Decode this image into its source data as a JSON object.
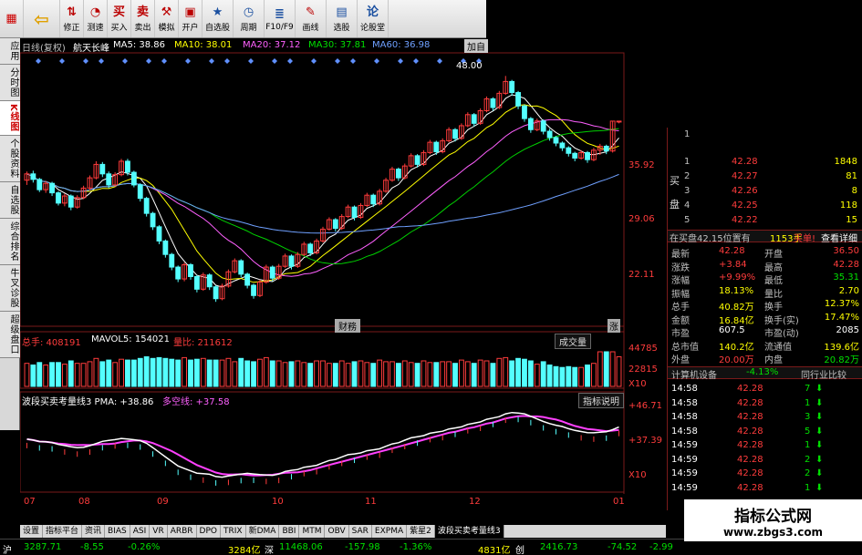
{
  "toolbar": {
    "buttons": [
      {
        "label": "",
        "icon": "grid-icon"
      },
      {
        "label": "",
        "icon": "back-arrow-icon"
      },
      {
        "label": "修正",
        "icon": "updown-icon"
      },
      {
        "label": "测速",
        "icon": "speed-icon"
      },
      {
        "label": "买入",
        "icon": "buy-icon"
      },
      {
        "label": "卖出",
        "icon": "sell-icon"
      },
      {
        "label": "模拟",
        "icon": "hammer-icon"
      },
      {
        "label": "开户",
        "icon": "account-icon"
      },
      {
        "label": "自选股",
        "icon": "star-icon"
      },
      {
        "label": "周期",
        "icon": "clock-icon"
      },
      {
        "label": "F10/F9",
        "icon": "f10-icon"
      },
      {
        "label": "画线",
        "icon": "pen-icon"
      },
      {
        "label": "选股",
        "icon": "filter-icon"
      },
      {
        "label": "论股堂",
        "icon": "forum-icon"
      }
    ]
  },
  "left_tabs": [
    "应用",
    "分时图",
    "K线图",
    "个股资料",
    "自选股",
    "综合排名",
    "牛叉诊股",
    "超级盘口"
  ],
  "active_left_tab": 2,
  "header": {
    "period": "日线(复权)",
    "stock": "航天长峰",
    "ma5": "MA5: 38.86",
    "ma10": "MA10: 38.01",
    "ma20": "MA20: 37.12",
    "ma30": "MA30: 37.81",
    "ma60": "MA60: 36.98",
    "add_label": "加自"
  },
  "price_axis": [
    "35.92",
    "29.06",
    "22.11"
  ],
  "price_high_label": "48.00",
  "markers": [
    "财務",
    "涨"
  ],
  "volume": {
    "total": "总手: 408191",
    "mavol5": "MAVOL5: 154021",
    "ratio": "量比: 211612",
    "panel_label": "成交量",
    "axis": [
      "44785",
      "22815",
      "X10"
    ]
  },
  "indicator": {
    "name": "波段买卖考量线3 PMA: +38.86",
    "line2": "多空线: +37.58",
    "panel_label": "指标说明",
    "axis": [
      "+46.71",
      "+37.39",
      "X10"
    ]
  },
  "x_axis": [
    "07",
    "08",
    "09",
    "10",
    "11",
    "12",
    "01"
  ],
  "chart_data": {
    "type": "candlestick",
    "price_range": [
      17,
      50
    ],
    "candles": [
      [
        34.8,
        35.6,
        34.2,
        35.9
      ],
      [
        35.6,
        34.9,
        34.5,
        36.0
      ],
      [
        34.9,
        33.6,
        33.3,
        35.1
      ],
      [
        33.6,
        34.4,
        33.2,
        34.7
      ],
      [
        34.4,
        33.2,
        32.8,
        34.6
      ],
      [
        33.2,
        31.9,
        31.6,
        33.4
      ],
      [
        31.9,
        32.8,
        31.5,
        33.1
      ],
      [
        32.8,
        31.4,
        31.0,
        33.0
      ],
      [
        31.4,
        32.6,
        31.2,
        32.9
      ],
      [
        32.6,
        33.8,
        32.4,
        34.1
      ],
      [
        33.8,
        35.1,
        33.5,
        35.4
      ],
      [
        35.1,
        36.8,
        34.9,
        37.2
      ],
      [
        36.8,
        35.6,
        35.2,
        37.1
      ],
      [
        35.6,
        34.2,
        33.8,
        35.9
      ],
      [
        34.2,
        35.5,
        34.0,
        35.8
      ],
      [
        35.5,
        37.2,
        35.3,
        37.5
      ],
      [
        37.2,
        35.8,
        35.4,
        37.5
      ],
      [
        35.8,
        34.2,
        33.9,
        36.0
      ],
      [
        34.2,
        32.5,
        32.1,
        34.4
      ],
      [
        32.5,
        30.6,
        30.2,
        32.7
      ],
      [
        30.6,
        28.9,
        28.5,
        30.8
      ],
      [
        28.9,
        27.1,
        26.7,
        29.1
      ],
      [
        27.1,
        25.4,
        25.0,
        27.3
      ],
      [
        25.4,
        23.8,
        23.4,
        25.6
      ],
      [
        23.8,
        22.3,
        21.9,
        24.0
      ],
      [
        22.3,
        24.1,
        22.0,
        24.4
      ],
      [
        24.1,
        22.6,
        22.2,
        24.3
      ],
      [
        22.6,
        21.0,
        20.6,
        22.8
      ],
      [
        21.0,
        22.8,
        20.8,
        23.1
      ],
      [
        22.8,
        21.3,
        20.9,
        23.0
      ],
      [
        21.3,
        19.8,
        19.4,
        21.5
      ],
      [
        19.8,
        21.4,
        19.6,
        21.7
      ],
      [
        21.4,
        23.2,
        21.2,
        23.5
      ],
      [
        23.2,
        24.6,
        23.0,
        24.9
      ],
      [
        24.6,
        22.9,
        22.5,
        24.8
      ],
      [
        22.9,
        21.5,
        21.1,
        23.1
      ],
      [
        21.5,
        20.2,
        19.8,
        21.7
      ],
      [
        20.2,
        21.9,
        20.0,
        22.2
      ],
      [
        21.9,
        23.8,
        21.7,
        24.1
      ],
      [
        23.8,
        22.4,
        22.0,
        24.0
      ],
      [
        22.4,
        23.9,
        22.2,
        24.2
      ],
      [
        23.9,
        25.2,
        23.7,
        25.5
      ],
      [
        25.2,
        23.9,
        23.5,
        25.4
      ],
      [
        23.9,
        25.4,
        23.7,
        25.7
      ],
      [
        25.4,
        26.7,
        25.2,
        27.0
      ],
      [
        26.7,
        25.6,
        25.2,
        26.9
      ],
      [
        25.6,
        27.1,
        25.4,
        27.4
      ],
      [
        27.1,
        28.6,
        26.9,
        28.9
      ],
      [
        28.6,
        29.8,
        28.4,
        30.1
      ],
      [
        29.8,
        28.7,
        28.3,
        30.0
      ],
      [
        28.7,
        30.2,
        28.5,
        30.5
      ],
      [
        30.2,
        31.4,
        30.0,
        31.7
      ],
      [
        31.4,
        30.1,
        29.7,
        31.6
      ],
      [
        30.1,
        31.6,
        29.9,
        31.9
      ],
      [
        31.6,
        32.9,
        31.4,
        33.2
      ],
      [
        32.9,
        31.8,
        31.4,
        33.1
      ],
      [
        31.8,
        33.4,
        31.6,
        33.7
      ],
      [
        33.4,
        34.8,
        33.2,
        35.1
      ],
      [
        34.8,
        36.2,
        34.6,
        36.5
      ],
      [
        36.2,
        35.1,
        34.7,
        36.4
      ],
      [
        35.1,
        36.6,
        34.9,
        36.9
      ],
      [
        36.6,
        37.9,
        36.4,
        38.2
      ],
      [
        37.9,
        36.8,
        36.4,
        38.1
      ],
      [
        36.8,
        38.3,
        36.6,
        38.6
      ],
      [
        38.3,
        39.6,
        38.1,
        39.9
      ],
      [
        39.6,
        38.4,
        38.0,
        39.8
      ],
      [
        38.4,
        39.8,
        38.2,
        40.1
      ],
      [
        39.8,
        41.2,
        39.6,
        41.5
      ],
      [
        41.2,
        40.1,
        39.7,
        41.4
      ],
      [
        40.1,
        41.7,
        39.9,
        42.0
      ],
      [
        41.7,
        43.1,
        41.5,
        43.4
      ],
      [
        43.1,
        42.0,
        41.6,
        43.3
      ],
      [
        42.0,
        43.6,
        41.8,
        43.9
      ],
      [
        43.6,
        45.1,
        43.4,
        45.4
      ],
      [
        45.1,
        44.0,
        43.6,
        45.3
      ],
      [
        44.0,
        45.8,
        43.8,
        46.1
      ],
      [
        45.8,
        47.3,
        45.6,
        48.0
      ],
      [
        47.3,
        45.9,
        45.5,
        47.5
      ],
      [
        45.9,
        44.2,
        43.8,
        46.1
      ],
      [
        44.2,
        42.6,
        42.2,
        44.4
      ],
      [
        42.6,
        41.2,
        40.8,
        42.8
      ],
      [
        41.2,
        42.3,
        41.0,
        42.6
      ],
      [
        42.3,
        41.0,
        40.6,
        42.5
      ],
      [
        41.0,
        40.2,
        39.8,
        41.3
      ],
      [
        40.2,
        39.5,
        39.1,
        40.4
      ],
      [
        39.5,
        38.9,
        38.5,
        39.7
      ],
      [
        38.9,
        38.2,
        37.8,
        39.1
      ],
      [
        38.2,
        37.6,
        37.2,
        38.4
      ],
      [
        37.6,
        38.3,
        37.4,
        38.6
      ],
      [
        38.3,
        37.4,
        37.0,
        38.5
      ],
      [
        37.4,
        38.6,
        37.2,
        38.9
      ],
      [
        38.6,
        39.1,
        38.0,
        39.4
      ],
      [
        39.1,
        38.5,
        38.1,
        39.3
      ],
      [
        38.5,
        42.28,
        38.3,
        42.28
      ],
      [
        42.28,
        42.28,
        42.0,
        42.28
      ]
    ]
  },
  "orderbook": {
    "sell_top": {
      "level": "1",
      "price": "",
      "vol": ""
    },
    "buy_label": "买盘",
    "buy": [
      {
        "level": "1",
        "price": "42.28",
        "vol": "1848"
      },
      {
        "level": "2",
        "price": "42.27",
        "vol": "81"
      },
      {
        "level": "3",
        "price": "42.26",
        "vol": "8"
      },
      {
        "level": "4",
        "price": "42.25",
        "vol": "118"
      },
      {
        "level": "5",
        "price": "42.22",
        "vol": "15"
      }
    ],
    "status_left": "在买盘42.15位置有",
    "status_mid": "1153手",
    "status_right": "买单!",
    "detail_link": "查看详细"
  },
  "quote": [
    {
      "k1": "最新",
      "v1": "42.28",
      "c1": "red",
      "k2": "开盘",
      "v2": "36.50",
      "c2": "red"
    },
    {
      "k1": "涨跌",
      "v1": "+3.84",
      "c1": "red",
      "k2": "最高",
      "v2": "42.28",
      "c2": "red"
    },
    {
      "k1": "涨幅",
      "v1": "+9.99%",
      "c1": "red",
      "k2": "最低",
      "v2": "35.31",
      "c2": "green"
    },
    {
      "k1": "振幅",
      "v1": "18.13%",
      "c1": "yellow",
      "k2": "量比",
      "v2": "2.70",
      "c2": "yellow"
    },
    {
      "k1": "总手",
      "v1": "40.82万",
      "c1": "yellow",
      "k2": "换手",
      "v2": "12.37%",
      "c2": "yellow"
    },
    {
      "k1": "金额",
      "v1": "16.84亿",
      "c1": "yellow",
      "k2": "换手(实)",
      "v2": "17.47%",
      "c2": "yellow"
    },
    {
      "k1": "市盈",
      "v1": "607.5",
      "c1": "white",
      "k2": "市盈(动)",
      "v2": "2085",
      "c2": "white"
    },
    {
      "k1": "总市值",
      "v1": "140.2亿",
      "c1": "yellow",
      "k2": "流通值",
      "v2": "139.6亿",
      "c2": "yellow"
    },
    {
      "k1": "外盘",
      "v1": "20.00万",
      "c1": "red",
      "k2": "内盘",
      "v2": "20.82万",
      "c2": "green"
    }
  ],
  "industry": {
    "name": "计算机设备",
    "change": "-4.13%",
    "compare": "同行业比较"
  },
  "ticks": [
    {
      "time": "14:58",
      "price": "42.28",
      "vol": "7",
      "dir": "down"
    },
    {
      "time": "14:58",
      "price": "42.28",
      "vol": "1",
      "dir": "down"
    },
    {
      "time": "14:58",
      "price": "42.28",
      "vol": "3",
      "dir": "down"
    },
    {
      "time": "14:58",
      "price": "42.28",
      "vol": "5",
      "dir": "down"
    },
    {
      "time": "14:59",
      "price": "42.28",
      "vol": "1",
      "dir": "down"
    },
    {
      "time": "14:59",
      "price": "42.28",
      "vol": "2",
      "dir": "down"
    },
    {
      "time": "14:59",
      "price": "42.28",
      "vol": "2",
      "dir": "down"
    },
    {
      "time": "14:59",
      "price": "42.28",
      "vol": "1",
      "dir": "down"
    }
  ],
  "indicator_tabs": [
    "设置",
    "指标平台",
    "资讯",
    "BIAS",
    "ASI",
    "VR",
    "ARBR",
    "DPO",
    "TRIX",
    "新DMA",
    "BBI",
    "MTM",
    "OBV",
    "SAR",
    "EXPMA",
    "紫星2",
    "波段买卖考量线3"
  ],
  "active_indicator_tab": 16,
  "statusbar": {
    "sh_label": "沪",
    "sh_index": "3287.71",
    "sh_change": "-8.55",
    "sh_pct": "-0.26%",
    "sh_amount": "3284亿",
    "sz_label": "深",
    "sz_index": "11468.06",
    "sz_change": "-157.98",
    "sz_pct": "-1.36%",
    "sz_amount": "4831亿",
    "cy_label": "创",
    "cy_index": "2416.73",
    "cy_change": "-74.52",
    "cy_pct": "-2.99"
  },
  "watermark": {
    "line1": "指标公式网",
    "line2": "www.zbgs3.com"
  }
}
